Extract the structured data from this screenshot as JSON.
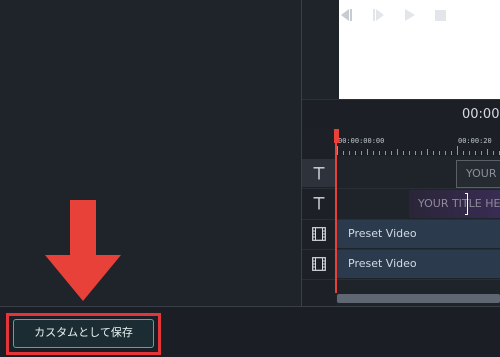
{
  "player": {
    "timecode": "00:00:"
  },
  "ruler": {
    "labels": [
      "00:00:00:00",
      "00:00:20"
    ]
  },
  "timeline": {
    "tracks": [
      {
        "type": "title",
        "icon": "title-t-icon",
        "clip_label": "YOUR"
      },
      {
        "type": "title",
        "icon": "title-t-icon",
        "clip_label": "YOUR TITLE HE"
      },
      {
        "type": "video",
        "icon": "film-icon",
        "clip_label": "Preset Video"
      },
      {
        "type": "video",
        "icon": "film-icon",
        "clip_label": "Preset Video"
      }
    ]
  },
  "footer": {
    "save_custom_label": "カスタムとして保存"
  },
  "annotation": {
    "arrow_icon": "down-arrow-icon",
    "arrow_color": "#e8413a",
    "highlight_color": "#e4363a"
  },
  "colors": {
    "accent": "#2fb6b5",
    "playhead": "#e8413a",
    "background": "#1f232a"
  }
}
